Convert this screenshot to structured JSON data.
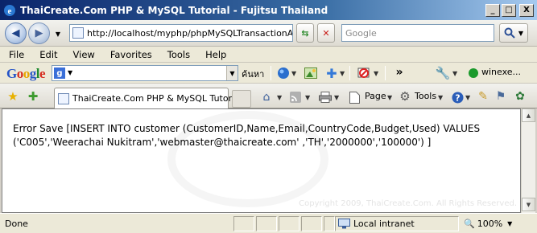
{
  "window": {
    "title": "ThaiCreate.Com PHP & MySQL Tutorial - Fujitsu Thailand",
    "minimize": "_",
    "maximize": "□",
    "close": "X"
  },
  "nav": {
    "url": "http://localhost/myphp/phpMySQLTransactionAdd",
    "search_placeholder": "Google"
  },
  "menu": [
    "File",
    "Edit",
    "View",
    "Favorites",
    "Tools",
    "Help"
  ],
  "google_toolbar": {
    "logo": "Google",
    "search_label": "ค้นหา",
    "more": "»",
    "account": "winexe..."
  },
  "tab": {
    "label": "ThaiCreate.Com PHP & MySQL Tutorial"
  },
  "commands": {
    "page": "Page",
    "tools": "Tools"
  },
  "content": {
    "message": "Error Save [INSERT INTO customer (CustomerID,Name,Email,CountryCode,Budget,Used) VALUES ('C005','Weerachai Nukitram','webmaster@thaicreate.com' ,'TH','2000000','100000') ]",
    "watermark": "Copyright 2009, ThaiCreate.Com. All Rights Reserved."
  },
  "status": {
    "text": "Done",
    "zone": "Local intranet",
    "zoom": "100%"
  },
  "colors": {
    "title_bar": "#0a246a",
    "chrome": "#ece9d8",
    "content_bg": "#ffffff"
  }
}
